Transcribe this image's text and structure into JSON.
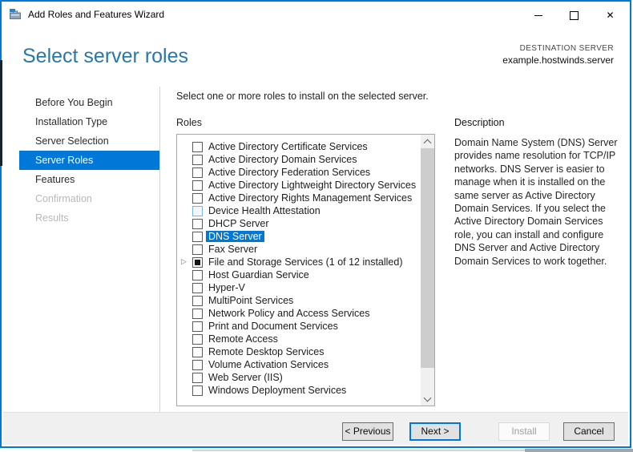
{
  "window": {
    "title": "Add Roles and Features Wizard",
    "controls": [
      {
        "name": "minimize"
      },
      {
        "name": "maximize"
      },
      {
        "name": "close"
      }
    ]
  },
  "header": {
    "title": "Select server roles",
    "destination_label": "DESTINATION SERVER",
    "destination_server": "example.hostwinds.server"
  },
  "sidebar": {
    "items": [
      {
        "label": "Before You Begin",
        "state": "normal"
      },
      {
        "label": "Installation Type",
        "state": "normal"
      },
      {
        "label": "Server Selection",
        "state": "normal"
      },
      {
        "label": "Server Roles",
        "state": "selected"
      },
      {
        "label": "Features",
        "state": "normal"
      },
      {
        "label": "Confirmation",
        "state": "disabled"
      },
      {
        "label": "Results",
        "state": "disabled"
      }
    ]
  },
  "main": {
    "instruction": "Select one or more roles to install on the selected server.",
    "roles_label": "Roles",
    "roles": [
      {
        "label": "Active Directory Certificate Services",
        "checked": false
      },
      {
        "label": "Active Directory Domain Services",
        "checked": false
      },
      {
        "label": "Active Directory Federation Services",
        "checked": false
      },
      {
        "label": "Active Directory Lightweight Directory Services",
        "checked": false
      },
      {
        "label": "Active Directory Rights Management Services",
        "checked": false
      },
      {
        "label": "Device Health Attestation",
        "checked": false,
        "hover": true
      },
      {
        "label": "DHCP Server",
        "checked": false
      },
      {
        "label": "DNS Server",
        "checked": false,
        "selected": true
      },
      {
        "label": "Fax Server",
        "checked": false
      },
      {
        "label": "File and Storage Services (1 of 12 installed)",
        "checked": "partial",
        "expandable": true
      },
      {
        "label": "Host Guardian Service",
        "checked": false
      },
      {
        "label": "Hyper-V",
        "checked": false
      },
      {
        "label": "MultiPoint Services",
        "checked": false
      },
      {
        "label": "Network Policy and Access Services",
        "checked": false
      },
      {
        "label": "Print and Document Services",
        "checked": false
      },
      {
        "label": "Remote Access",
        "checked": false
      },
      {
        "label": "Remote Desktop Services",
        "checked": false
      },
      {
        "label": "Volume Activation Services",
        "checked": false
      },
      {
        "label": "Web Server (IIS)",
        "checked": false
      },
      {
        "label": "Windows Deployment Services",
        "checked": false
      }
    ],
    "expand_icon_glyph": "▷"
  },
  "description": {
    "heading": "Description",
    "text": "Domain Name System (DNS) Server provides name resolution for TCP/IP networks. DNS Server is easier to manage when it is installed on the same server as Active Directory Domain Services. If you select the Active Directory Domain Services role, you can install and configure DNS Server and Active Directory Domain Services to work together."
  },
  "footer": {
    "buttons": [
      {
        "label": "< Previous",
        "state": "normal"
      },
      {
        "label": "Next >",
        "state": "default"
      },
      {
        "label": "Install",
        "state": "disabled"
      },
      {
        "label": "Cancel",
        "state": "normal"
      }
    ]
  },
  "colors": {
    "accent": "#0078d7",
    "heading": "#2878a8",
    "footer_bg": "#f0f0f0",
    "selected_text_bg": "#0078d7"
  }
}
